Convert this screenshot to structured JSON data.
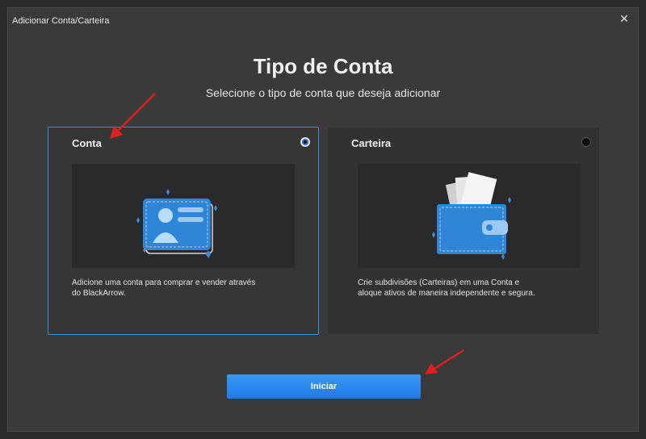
{
  "window": {
    "title": "Adicionar Conta/Carteira",
    "close_glyph": "✕"
  },
  "heading": "Tipo de Conta",
  "subheading": "Selecione o tipo de conta que deseja adicionar",
  "cards": [
    {
      "title": "Conta",
      "selected": true,
      "description_line1": "Adicione uma conta para comprar e vender através",
      "description_line2": "do BlackArrow.",
      "icon": "id-card-icon"
    },
    {
      "title": "Carteira",
      "selected": false,
      "description_line1": "Crie subdivisões (Carteiras) em uma Conta e",
      "description_line2": "aloque ativos de maneira independente e segura.",
      "icon": "wallet-icon"
    }
  ],
  "start_button": {
    "label": "Iniciar"
  },
  "colors": {
    "accent": "#1f7ae8",
    "selected_border": "#3a8de0",
    "annotation_arrow": "#e02020",
    "illustration_blue": "#2f86d6"
  }
}
